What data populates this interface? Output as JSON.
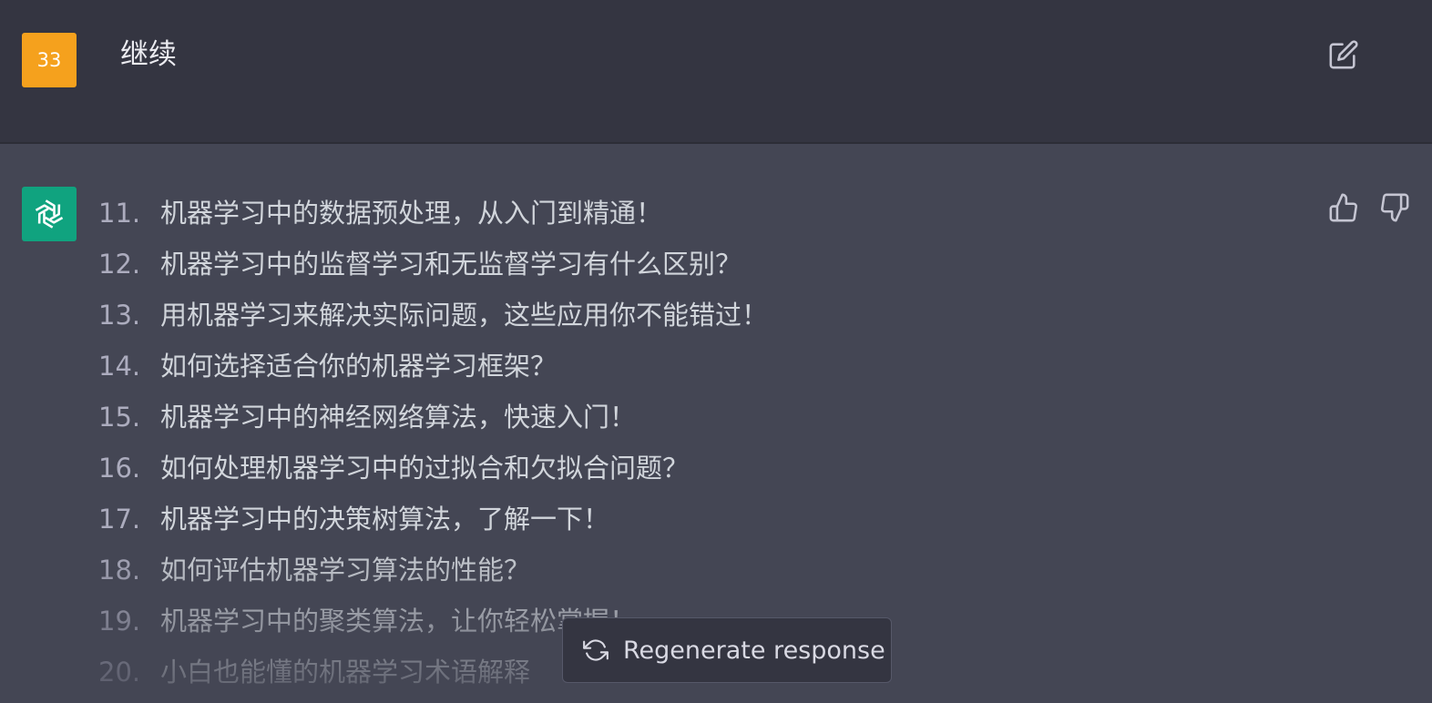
{
  "user_message": {
    "avatar_label": "33",
    "text": "继续"
  },
  "assistant_message": {
    "items": [
      {
        "num": "11.",
        "text": "机器学习中的数据预处理，从入门到精通！"
      },
      {
        "num": "12.",
        "text": "机器学习中的监督学习和无监督学习有什么区别？"
      },
      {
        "num": "13.",
        "text": "用机器学习来解决实际问题，这些应用你不能错过！"
      },
      {
        "num": "14.",
        "text": "如何选择适合你的机器学习框架？"
      },
      {
        "num": "15.",
        "text": "机器学习中的神经网络算法，快速入门！"
      },
      {
        "num": "16.",
        "text": "如何处理机器学习中的过拟合和欠拟合问题？"
      },
      {
        "num": "17.",
        "text": "机器学习中的决策树算法，了解一下！"
      },
      {
        "num": "18.",
        "text": "如何评估机器学习算法的性能？"
      },
      {
        "num": "19.",
        "text": "机器学习中的聚类算法，让你轻松掌握！"
      },
      {
        "num": "20.",
        "text": "小白也能懂的机器学习术语解释"
      }
    ]
  },
  "regenerate": {
    "label": "Regenerate response",
    "icon": "refresh-icon"
  },
  "icons": {
    "edit": "edit-icon",
    "thumbs_up": "thumbs-up-icon",
    "thumbs_down": "thumbs-down-icon",
    "assistant_logo": "openai-logo-icon"
  },
  "colors": {
    "user_bg": "#343541",
    "assistant_bg": "#444654",
    "user_avatar": "#f5a11d",
    "assistant_avatar": "#10a37f"
  }
}
